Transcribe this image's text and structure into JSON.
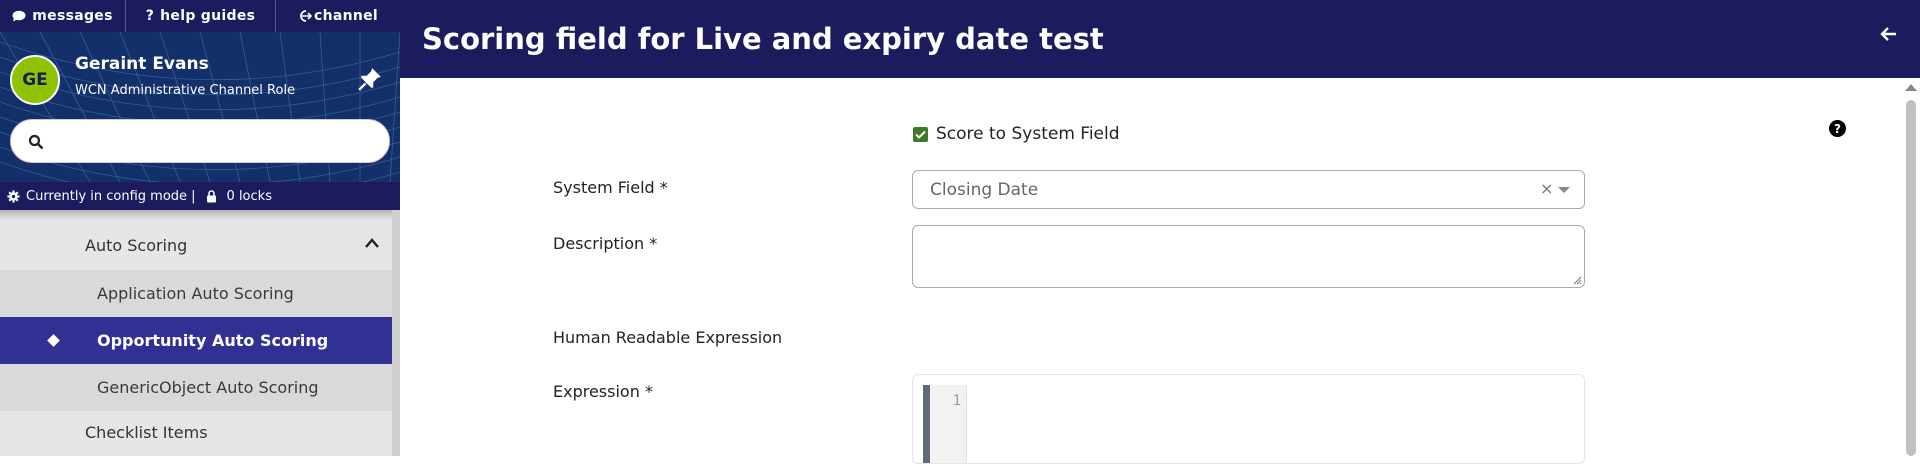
{
  "topnav": {
    "items": [
      {
        "label": "messages",
        "icon": "chat-bubble-icon"
      },
      {
        "label": "help guides",
        "icon": "question-icon"
      },
      {
        "label": "channel",
        "icon": "channel-icon"
      }
    ]
  },
  "user": {
    "initials": "GE",
    "name": "Geraint Evans",
    "role": "WCN Administrative Channel Role",
    "avatar_color": "#8fc200"
  },
  "search": {
    "placeholder": "",
    "value": ""
  },
  "config_bar": {
    "mode_text": "Currently in config mode |",
    "locks_text": "0 locks"
  },
  "sidebar_nav": {
    "parent": "Auto Scoring",
    "children": [
      {
        "label": "Application Auto Scoring",
        "active": false
      },
      {
        "label": "Opportunity Auto Scoring",
        "active": true
      },
      {
        "label": "GenericObject Auto Scoring",
        "active": false
      }
    ],
    "next_parent": "Checklist Items"
  },
  "header": {
    "title": "Scoring field for Live and expiry date test"
  },
  "form": {
    "score_checkbox_label": "Score to System Field",
    "score_checked": true,
    "system_field_label": "System Field *",
    "system_field_value": "Closing Date",
    "clear_symbol": "×",
    "description_label": "Description *",
    "description_value": "",
    "human_readable_label": "Human Readable Expression",
    "expression_label": "Expression *",
    "expression_line_number": "1",
    "help_symbol": "?"
  },
  "colors": {
    "header_bg": "#1b1b5e",
    "active_nav": "#303193",
    "checkbox": "#3d7a27"
  }
}
